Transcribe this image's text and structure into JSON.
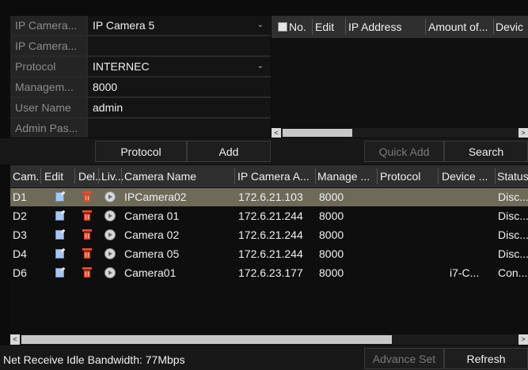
{
  "form": {
    "rows": [
      {
        "label": "IP Camera...",
        "value": "IP Camera 5",
        "dropdown": true
      },
      {
        "label": "IP Camera...",
        "value": "",
        "dropdown": false
      },
      {
        "label": "Protocol",
        "value": "INTERNEC",
        "dropdown": true
      },
      {
        "label": "Managem...",
        "value": "8000",
        "dropdown": false
      },
      {
        "label": "User Name",
        "value": "admin",
        "dropdown": false
      },
      {
        "label": "Admin Pas...",
        "value": "",
        "dropdown": false
      }
    ]
  },
  "search_list": {
    "columns": [
      "No.",
      "Edit",
      "IP Address",
      "Amount of...",
      "Devic"
    ],
    "scroll_left": "<",
    "scroll_right": ">"
  },
  "buttons": {
    "protocol": "Protocol",
    "add": "Add",
    "quick_add": "Quick Add",
    "search": "Search",
    "advance_set": "Advance Set",
    "refresh": "Refresh"
  },
  "camera_table": {
    "columns": [
      "Cam...",
      "Edit",
      "Del...",
      "Liv...",
      "Camera Name",
      "IP Camera A...",
      "Manage ...",
      "Protocol",
      "Device ...",
      "Status"
    ],
    "rows": [
      {
        "cam": "D1",
        "name": "IPCamera02",
        "ip": "172.6.21.103",
        "port": "8000",
        "protocol": "",
        "device": "",
        "status": "Disc...",
        "selected": true
      },
      {
        "cam": "D2",
        "name": "Camera 01",
        "ip": "172.6.21.244",
        "port": "8000",
        "protocol": "",
        "device": "",
        "status": "Disc...",
        "selected": false
      },
      {
        "cam": "D3",
        "name": "Camera 02",
        "ip": "172.6.21.244",
        "port": "8000",
        "protocol": "",
        "device": "",
        "status": "Disc...",
        "selected": false
      },
      {
        "cam": "D4",
        "name": "Camera 05",
        "ip": "172.6.21.244",
        "port": "8000",
        "protocol": "",
        "device": "",
        "status": "Disc...",
        "selected": false
      },
      {
        "cam": "D6",
        "name": "Camera01",
        "ip": "172.6.23.177",
        "port": "8000",
        "protocol": "",
        "device": "i7-C...",
        "status": "Con...",
        "selected": false
      }
    ],
    "scroll_left": "<",
    "scroll_right": ">"
  },
  "status_text": "Net Receive Idle Bandwidth: 77Mbps",
  "colors": {
    "selected_row": "#6d6a58",
    "delete_icon": "#e84a2c",
    "edit_icon": "#a9c7ee"
  }
}
